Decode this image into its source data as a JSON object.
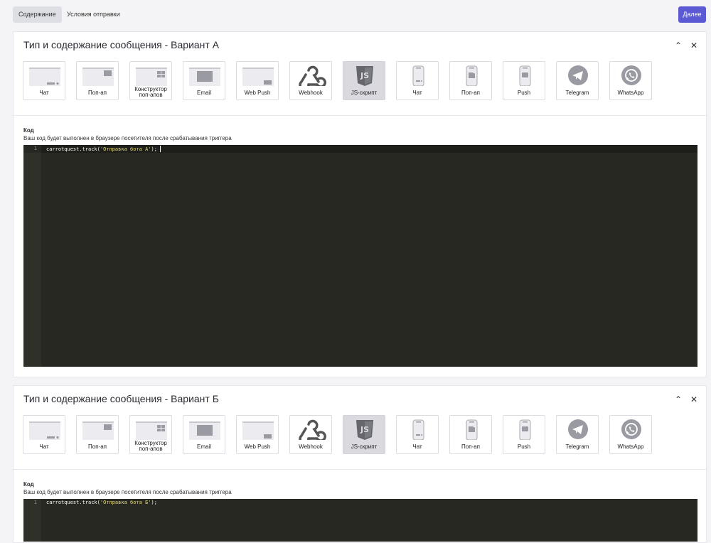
{
  "topbar": {
    "tabs": [
      {
        "label": "Содержание",
        "active": true
      },
      {
        "label": "Условия отправки",
        "active": false
      }
    ],
    "next_label": "Далее"
  },
  "accent_color": "#5b59d4",
  "message_types": [
    {
      "label": "Чат",
      "icon": "web-chat-icon"
    },
    {
      "label": "Поп-ап",
      "icon": "web-popup-icon"
    },
    {
      "label": "Конструктор поп-апов",
      "icon": "popup-builder-icon"
    },
    {
      "label": "Email",
      "icon": "email-icon"
    },
    {
      "label": "Web Push",
      "icon": "web-push-icon"
    },
    {
      "label": "Webhook",
      "icon": "webhook-icon"
    },
    {
      "label": "JS-скрипт",
      "icon": "js-icon"
    },
    {
      "label": "Чат",
      "icon": "mobile-chat-icon"
    },
    {
      "label": "Поп-ап",
      "icon": "mobile-popup-icon"
    },
    {
      "label": "Push",
      "icon": "mobile-push-icon"
    },
    {
      "label": "Telegram",
      "icon": "telegram-icon"
    },
    {
      "label": "WhatsApp",
      "icon": "whatsapp-icon"
    }
  ],
  "variants": [
    {
      "title": "Тип и содержание сообщения - Вариант А",
      "selected_type": "JS-скрипт",
      "code_label": "Код",
      "code_description": "Ваш код будет выполнен в браузере посетителя после срабатывания триггера",
      "line_number": "1",
      "code_prefix": "carrotquest.track(",
      "code_string": "'Отправка бота А'",
      "code_suffix": ");"
    },
    {
      "title": "Тип и содержание сообщения - Вариант Б",
      "selected_type": "JS-скрипт",
      "code_label": "Код",
      "code_description": "Ваш код будет выполнен в браузере посетителя после срабатывания триггера",
      "line_number": "1",
      "code_prefix": "carrotquest.track(",
      "code_string": "'Отправка бота Б'",
      "code_suffix": ");"
    }
  ]
}
